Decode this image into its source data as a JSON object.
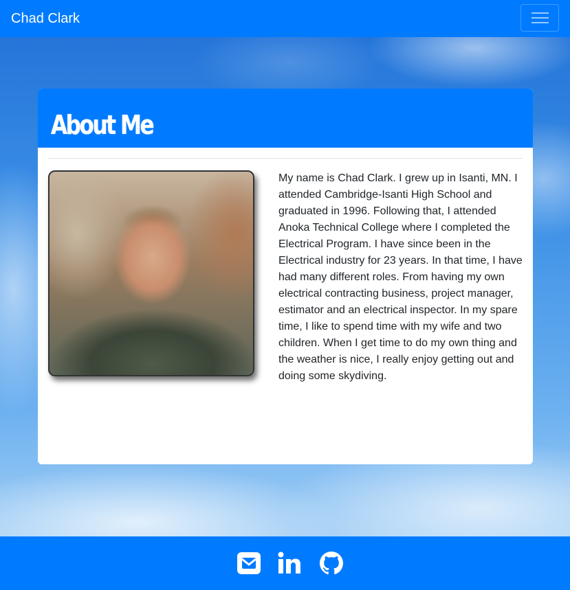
{
  "navbar": {
    "brand": "Chad Clark",
    "toggler_icon": "hamburger-menu-icon"
  },
  "about": {
    "title": "About Me",
    "photo_alt": "Chad Clark",
    "bio": "My name is Chad Clark. I grew up in Isanti, MN. I attended Cambridge-Isanti High School and graduated in 1996. Following that, I attended Anoka Technical College where I completed the Electrical Program. I have since been in the Electrical industry for 23 years. In that time, I have had many different roles. From having my own electrical contracting business, project manager, estimator and an electrical inspector. In my spare time, I like to spend time with my wife and two children. When I get time to do my own thing and the weather is nice, I really enjoy getting out and doing some skydiving."
  },
  "footer": {
    "icons": [
      "envelope-icon",
      "linkedin-icon",
      "github-icon"
    ]
  },
  "colors": {
    "primary": "#007bff",
    "card_background": "#ffffff",
    "text": "#212529"
  }
}
